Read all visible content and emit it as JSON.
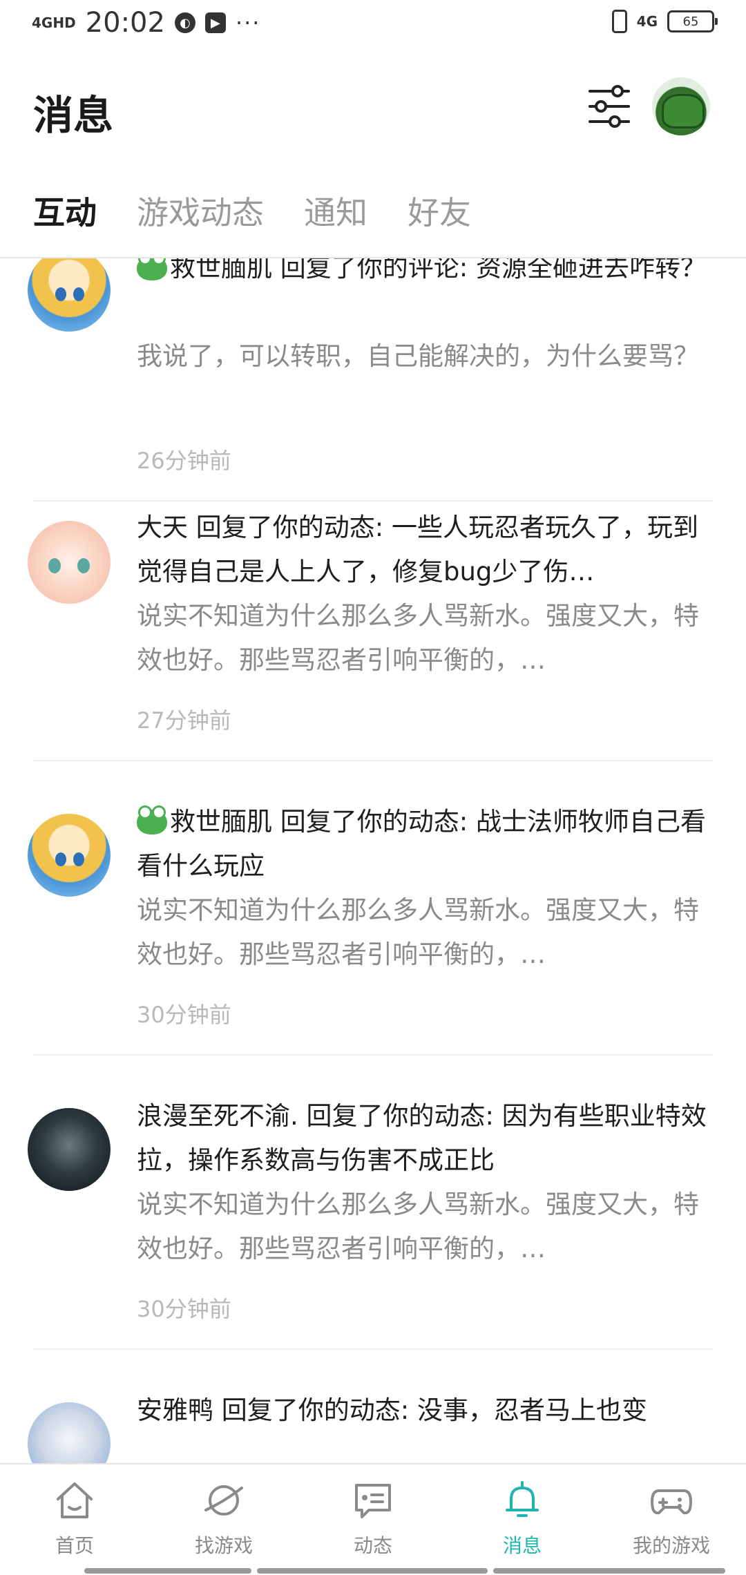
{
  "status_bar": {
    "network": "4GHD",
    "time": "20:02",
    "more": "···",
    "signal_right": "4G",
    "battery": "65"
  },
  "header": {
    "title": "消息"
  },
  "tabs": [
    {
      "label": "互动",
      "active": true
    },
    {
      "label": "游戏动态",
      "active": false
    },
    {
      "label": "通知",
      "active": false
    },
    {
      "label": "好友",
      "active": false
    }
  ],
  "items": [
    {
      "title": "救世腼肌 回复了你的评论: 资源全砸进去咋转？",
      "reply": "我说了，可以转职，自己能解决的，为什么要骂？",
      "time": "26分钟前"
    },
    {
      "title": "大天 回复了你的动态: 一些人玩忍者玩久了，玩到觉得自己是人上人了，修复bug少了伤…",
      "reply": "说实不知道为什么那么多人骂新水。强度又大，特效也好。那些骂忍者引响平衡的，…",
      "time": "27分钟前"
    },
    {
      "title": "救世腼肌 回复了你的动态: 战士法师牧师自己看看什么玩应",
      "reply": "说实不知道为什么那么多人骂新水。强度又大，特效也好。那些骂忍者引响平衡的，…",
      "time": "30分钟前"
    },
    {
      "title": "浪漫至死不渝. 回复了你的动态: 因为有些职业特效拉，操作系数高与伤害不成正比",
      "reply": "说实不知道为什么那么多人骂新水。强度又大，特效也好。那些骂忍者引响平衡的，…",
      "time": "30分钟前"
    },
    {
      "title": "安雅鸭 回复了你的动态: 没事，忍者马上也变"
    }
  ],
  "bottom_nav": [
    {
      "label": "首页",
      "icon": "home-icon",
      "active": false
    },
    {
      "label": "找游戏",
      "icon": "planet-icon",
      "active": false
    },
    {
      "label": "动态",
      "icon": "chat-icon",
      "active": false
    },
    {
      "label": "消息",
      "icon": "bell-icon",
      "active": true
    },
    {
      "label": "我的游戏",
      "icon": "gamepad-icon",
      "active": false
    }
  ],
  "colors": {
    "accent": "#1fb5b0",
    "text_primary": "#1e1e1e",
    "text_secondary": "#8a8a8a",
    "text_time": "#b8b8b8"
  }
}
